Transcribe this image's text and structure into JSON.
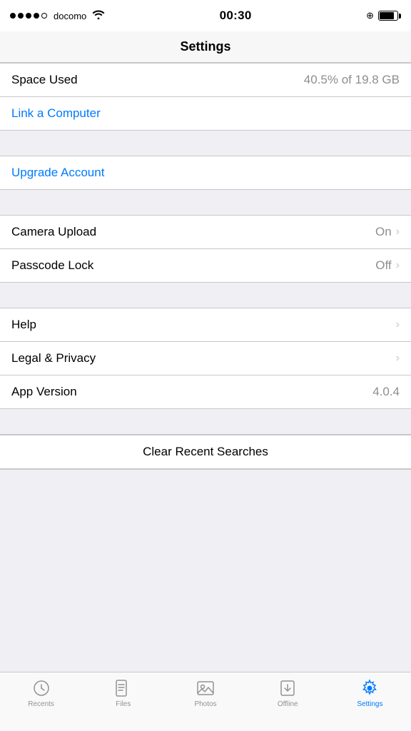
{
  "statusBar": {
    "carrier": "docomo",
    "time": "00:30"
  },
  "navTitle": "Settings",
  "sections": {
    "storage": {
      "label": "Space Used",
      "value": "40.5% of 19.8 GB"
    },
    "linkComputer": "Link a Computer",
    "upgradeAccount": "Upgrade Account",
    "cameraUpload": {
      "label": "Camera Upload",
      "value": "On"
    },
    "passcodeLock": {
      "label": "Passcode Lock",
      "value": "Off"
    },
    "help": {
      "label": "Help"
    },
    "legalPrivacy": {
      "label": "Legal & Privacy"
    },
    "appVersion": {
      "label": "App Version",
      "value": "4.0.4"
    },
    "clearSearches": "Clear Recent Searches"
  },
  "tabBar": {
    "items": [
      {
        "id": "recents",
        "label": "Recents",
        "active": false
      },
      {
        "id": "files",
        "label": "Files",
        "active": false
      },
      {
        "id": "photos",
        "label": "Photos",
        "active": false
      },
      {
        "id": "offline",
        "label": "Offline",
        "active": false
      },
      {
        "id": "settings",
        "label": "Settings",
        "active": true
      }
    ]
  }
}
